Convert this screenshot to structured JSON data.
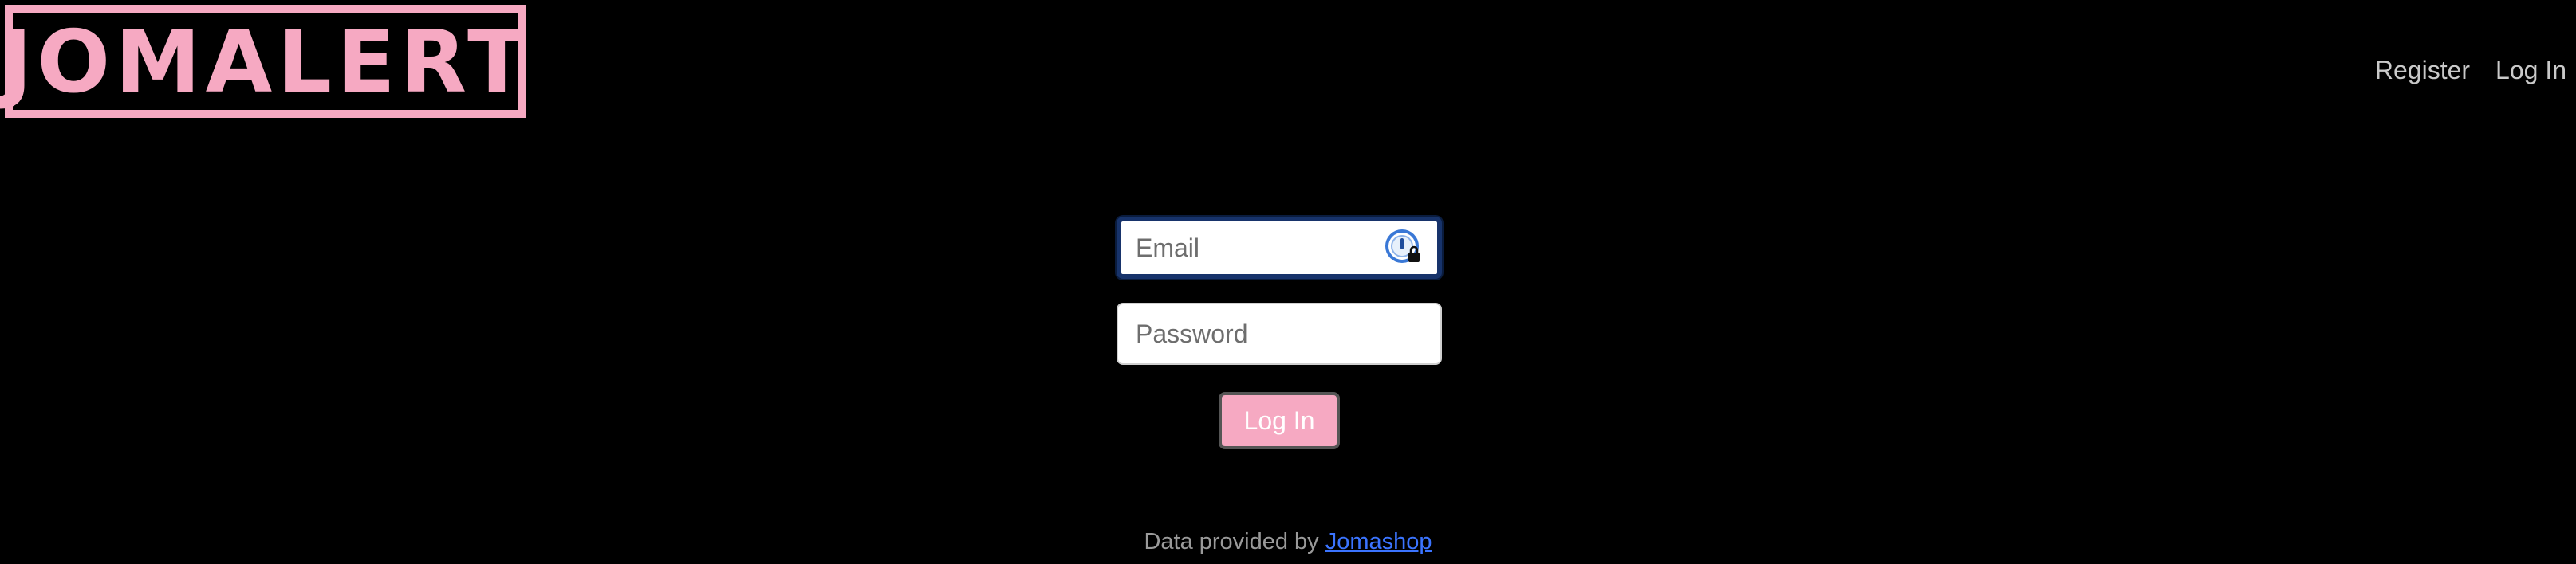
{
  "logo": {
    "text": "JOMALERT"
  },
  "nav": {
    "register": "Register",
    "login": "Log In"
  },
  "form": {
    "email_placeholder": "Email",
    "password_placeholder": "Password",
    "submit_label": "Log In",
    "password_manager_icon": "password-manager-lock-icon"
  },
  "footer": {
    "prefix": "Data provided by",
    "link_text": "Jomashop"
  },
  "colors": {
    "brand_pink": "#f6a9c2",
    "background": "#000000",
    "link_blue": "#3b74ff",
    "focus_ring": "#17336b"
  }
}
